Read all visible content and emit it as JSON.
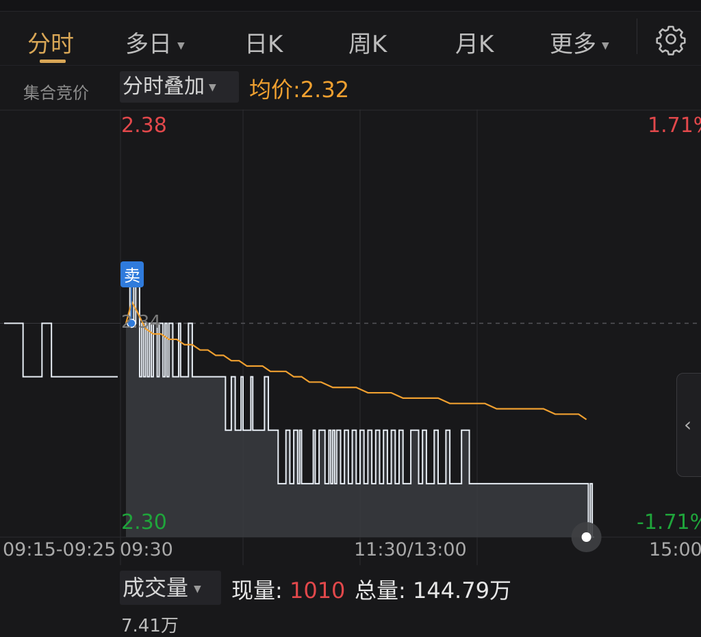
{
  "tabs": [
    {
      "label": "分时",
      "active": true,
      "has_caret": false
    },
    {
      "label": "多日",
      "active": false,
      "has_caret": true
    },
    {
      "label": "日K",
      "active": false,
      "has_caret": false
    },
    {
      "label": "周K",
      "active": false,
      "has_caret": false
    },
    {
      "label": "月K",
      "active": false,
      "has_caret": false
    },
    {
      "label": "更多",
      "active": false,
      "has_caret": true
    }
  ],
  "settings_icon": "gear-icon",
  "subbar": {
    "auction_label": "集合竞价",
    "overlay_label": "分时叠加",
    "avg_label": "均价:",
    "avg_value": "2.32"
  },
  "chart": {
    "price_high": "2.38",
    "price_low": "2.30",
    "pct_high": "1.71%",
    "pct_low": "-1.71%",
    "prev_close": "2.34",
    "sell_marker": "卖",
    "times": {
      "auction": "09:15-09:25",
      "open": "09:30",
      "mid": "11:30/13:00",
      "close": "15:00"
    },
    "colors": {
      "up": "#e2484b",
      "down": "#1fa53b",
      "avg": "#f0a030",
      "price": "#e8eef5",
      "sell": "#2f7bdc"
    }
  },
  "volume": {
    "label": "成交量",
    "current_label": "现量:",
    "current_value": "1010",
    "total_label": "总量:",
    "total_value": "144.79万",
    "max_label": "7.41万"
  },
  "chart_data": {
    "type": "line",
    "title": "",
    "xlabel": "",
    "ylabel": "",
    "ylim": [
      2.3,
      2.38
    ],
    "prev_close": 2.34,
    "x_ticks": [
      "09:30",
      "11:30/13:00",
      "15:00"
    ],
    "auction": {
      "x": [
        0,
        1,
        2,
        3,
        4,
        5,
        6,
        7,
        8,
        9,
        10,
        11,
        12
      ],
      "values": [
        2.34,
        2.34,
        2.33,
        2.33,
        2.34,
        2.33,
        2.33,
        2.33,
        2.33,
        2.33,
        2.33,
        2.33,
        2.33
      ]
    },
    "series": [
      {
        "name": "",
        "x": [
          0,
          2,
          3,
          4,
          5,
          7,
          8,
          9,
          10,
          11,
          12,
          13,
          14,
          16,
          17,
          19,
          20,
          21,
          22,
          24,
          25,
          27,
          28,
          29,
          30,
          32,
          34,
          35,
          37,
          38,
          40,
          42,
          43,
          45,
          46,
          48,
          50,
          51,
          52,
          54,
          56,
          57,
          58,
          59,
          60,
          62,
          64,
          65,
          66,
          67,
          68,
          69,
          70,
          71,
          73,
          74,
          75,
          77,
          78,
          80,
          81,
          82,
          84,
          85,
          86,
          88,
          89,
          90,
          92,
          94,
          96,
          97,
          98,
          99,
          100,
          102,
          104,
          105,
          106,
          107,
          108,
          110,
          112,
          114,
          116,
          118,
          120,
          122,
          124,
          126,
          128,
          130,
          132,
          134,
          136,
          138,
          140,
          142,
          144,
          146,
          148,
          150,
          152,
          154,
          156,
          158,
          160,
          162,
          164,
          166,
          168,
          170,
          172,
          174,
          176,
          178,
          180,
          182,
          184,
          186,
          188,
          190,
          192,
          194,
          196,
          198,
          200,
          202,
          204,
          206,
          208,
          210,
          212,
          214,
          216,
          218,
          220,
          222,
          224,
          226,
          228,
          230,
          232,
          234,
          236,
          237,
          238,
          239,
          240
        ],
        "values": [
          2.34,
          2.35,
          2.35,
          2.34,
          2.35,
          2.33,
          2.34,
          2.33,
          2.34,
          2.33,
          2.34,
          2.33,
          2.34,
          2.33,
          2.34,
          2.33,
          2.34,
          2.33,
          2.34,
          2.33,
          2.33,
          2.34,
          2.33,
          2.33,
          2.33,
          2.34,
          2.33,
          2.33,
          2.33,
          2.33,
          2.33,
          2.33,
          2.33,
          2.33,
          2.33,
          2.33,
          2.33,
          2.32,
          2.32,
          2.33,
          2.32,
          2.32,
          2.32,
          2.33,
          2.32,
          2.32,
          2.33,
          2.32,
          2.32,
          2.32,
          2.32,
          2.32,
          2.32,
          2.33,
          2.32,
          2.32,
          2.32,
          2.32,
          2.31,
          2.31,
          2.31,
          2.32,
          2.31,
          2.31,
          2.32,
          2.31,
          2.32,
          2.31,
          2.31,
          2.31,
          2.32,
          2.31,
          2.31,
          2.32,
          2.32,
          2.31,
          2.32,
          2.31,
          2.32,
          2.31,
          2.32,
          2.31,
          2.32,
          2.31,
          2.32,
          2.31,
          2.32,
          2.31,
          2.32,
          2.31,
          2.32,
          2.31,
          2.32,
          2.31,
          2.32,
          2.31,
          2.32,
          2.31,
          2.31,
          2.32,
          2.32,
          2.31,
          2.32,
          2.31,
          2.31,
          2.32,
          2.31,
          2.31,
          2.32,
          2.31,
          2.31,
          2.31,
          2.32,
          2.32,
          2.31,
          2.31,
          2.31,
          2.31,
          2.31,
          2.31,
          2.31,
          2.31,
          2.31,
          2.31,
          2.31,
          2.31,
          2.31,
          2.31,
          2.31,
          2.31,
          2.31,
          2.31,
          2.31,
          2.31,
          2.31,
          2.31,
          2.31,
          2.31,
          2.31,
          2.31,
          2.31,
          2.31,
          2.31,
          2.31,
          2.31,
          2.3,
          2.31,
          2.3,
          2.3
        ]
      },
      {
        "name": "均价",
        "x": [
          0,
          3,
          6,
          10,
          14,
          18,
          22,
          26,
          30,
          34,
          38,
          42,
          46,
          50,
          54,
          58,
          62,
          66,
          70,
          74,
          78,
          82,
          86,
          90,
          94,
          100,
          106,
          112,
          118,
          124,
          130,
          136,
          142,
          148,
          154,
          160,
          166,
          172,
          178,
          184,
          190,
          196,
          202,
          208,
          214,
          220,
          226,
          232,
          236
        ],
        "values": [
          2.34,
          2.344,
          2.342,
          2.339,
          2.338,
          2.338,
          2.337,
          2.337,
          2.336,
          2.336,
          2.335,
          2.335,
          2.334,
          2.334,
          2.333,
          2.333,
          2.332,
          2.332,
          2.332,
          2.331,
          2.331,
          2.331,
          2.33,
          2.33,
          2.329,
          2.329,
          2.328,
          2.328,
          2.328,
          2.327,
          2.327,
          2.327,
          2.326,
          2.326,
          2.326,
          2.326,
          2.325,
          2.325,
          2.325,
          2.325,
          2.324,
          2.324,
          2.324,
          2.324,
          2.324,
          2.323,
          2.323,
          2.323,
          2.322
        ]
      }
    ]
  }
}
